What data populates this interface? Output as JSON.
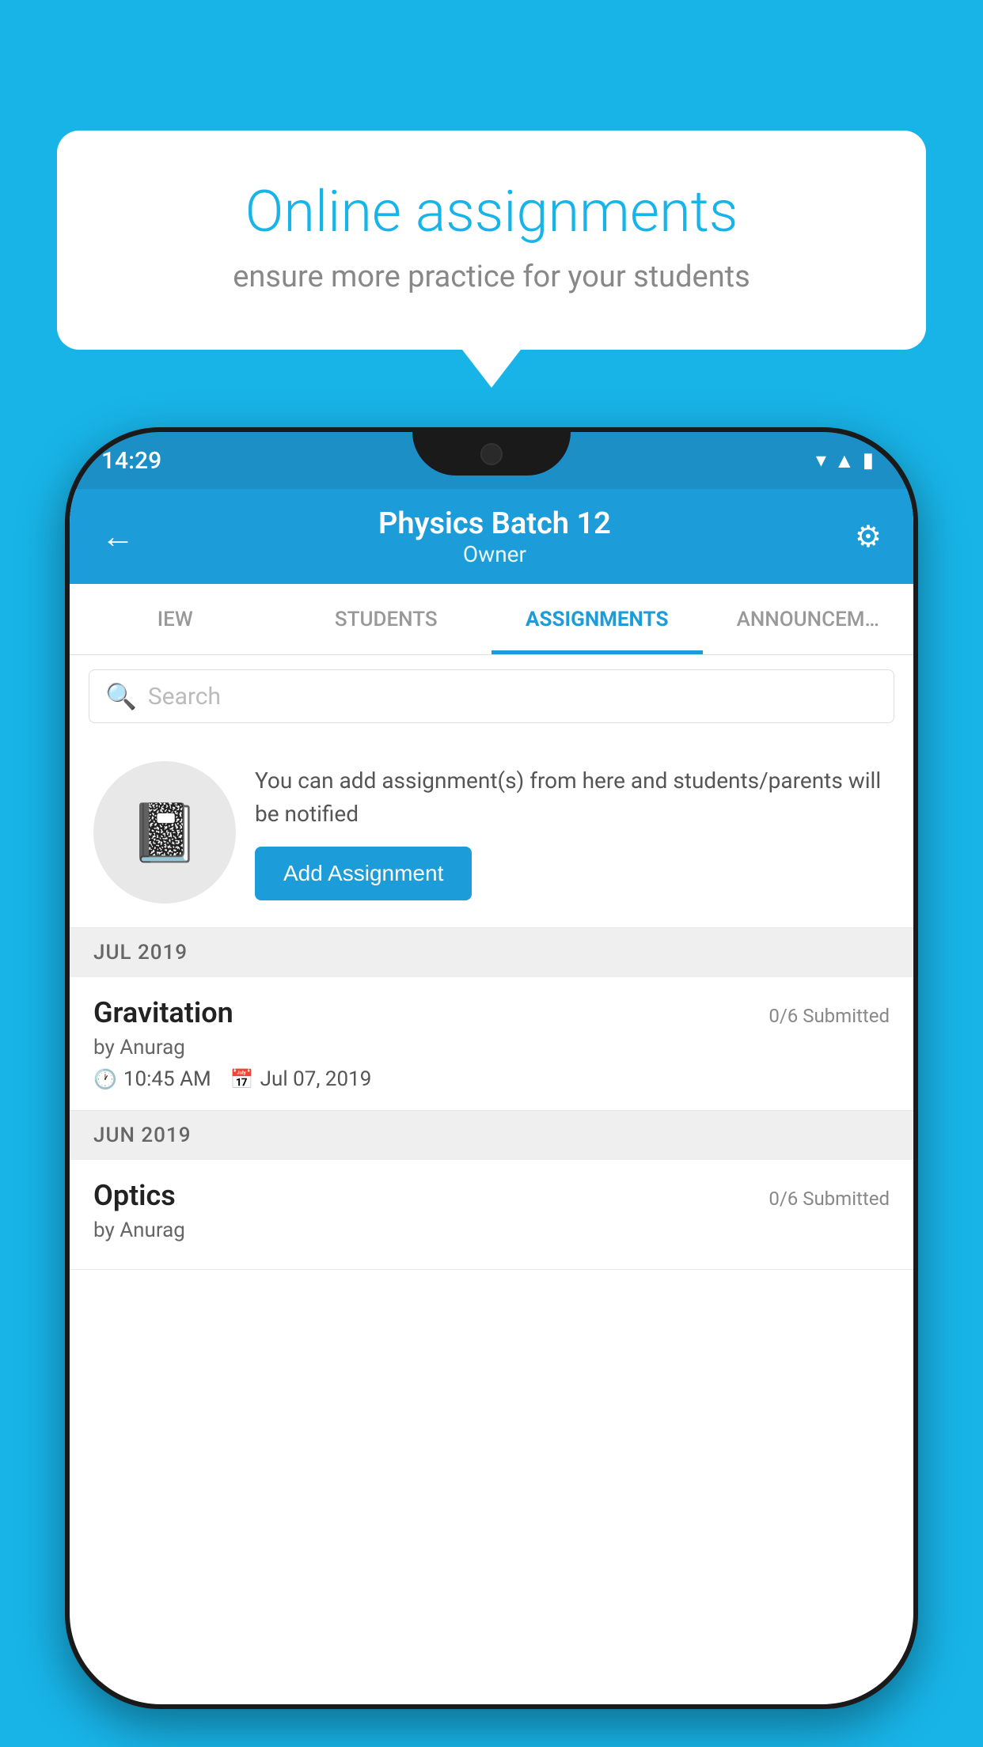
{
  "background_color": "#18b4e8",
  "speech_bubble": {
    "title": "Online assignments",
    "subtitle": "ensure more practice for your students"
  },
  "phone": {
    "status_bar": {
      "time": "14:29",
      "icons": [
        "wifi",
        "signal",
        "battery"
      ]
    },
    "header": {
      "title": "Physics Batch 12",
      "subtitle": "Owner",
      "back_label": "←",
      "settings_label": "⚙"
    },
    "tabs": [
      {
        "label": "IEW",
        "active": false
      },
      {
        "label": "STUDENTS",
        "active": false
      },
      {
        "label": "ASSIGNMENTS",
        "active": true
      },
      {
        "label": "ANNOUNCEM…",
        "active": false
      }
    ],
    "search": {
      "placeholder": "Search"
    },
    "promo": {
      "description": "You can add assignment(s) from here and students/parents will be notified",
      "button_label": "Add Assignment"
    },
    "sections": [
      {
        "month": "JUL 2019",
        "assignments": [
          {
            "title": "Gravitation",
            "submitted": "0/6 Submitted",
            "by": "by Anurag",
            "time": "10:45 AM",
            "date": "Jul 07, 2019"
          }
        ]
      },
      {
        "month": "JUN 2019",
        "assignments": [
          {
            "title": "Optics",
            "submitted": "0/6 Submitted",
            "by": "by Anurag",
            "time": "",
            "date": ""
          }
        ]
      }
    ]
  }
}
